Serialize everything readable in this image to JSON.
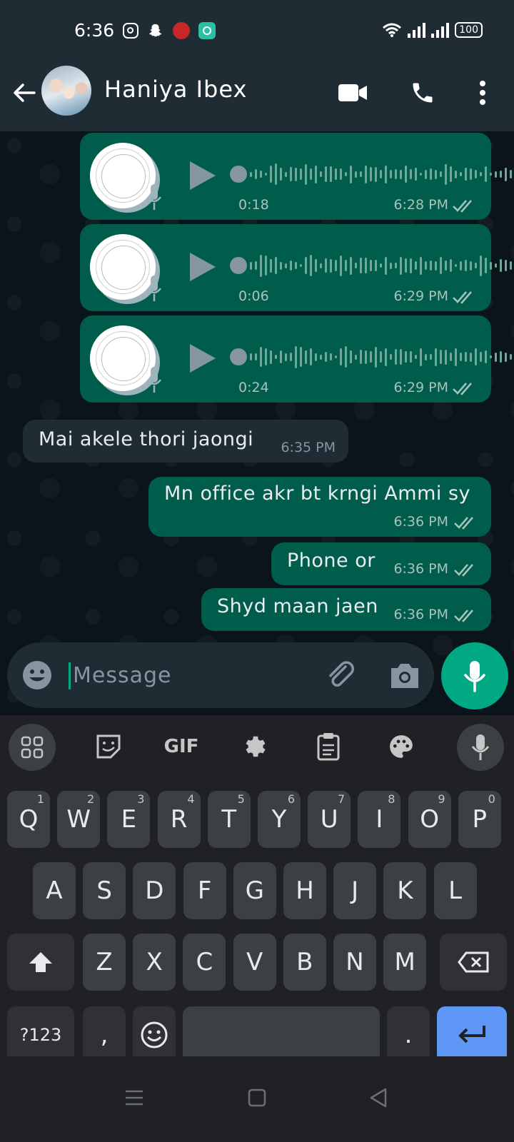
{
  "status_bar": {
    "time": "6:36",
    "battery": "100",
    "icons": [
      "instagram-icon",
      "snapchat-icon",
      "notification-app-icon",
      "chat-app-icon",
      "wifi-icon",
      "signal-icon",
      "signal-icon",
      "battery-icon"
    ]
  },
  "header": {
    "contact_name": "Haniya Ibex",
    "icons": [
      "back-arrow-icon",
      "video-call-icon",
      "phone-icon",
      "more-vert-icon"
    ]
  },
  "messages": [
    {
      "type": "voice",
      "direction": "out",
      "duration": "0:18",
      "time": "6:28 PM",
      "status": "read"
    },
    {
      "type": "voice",
      "direction": "out",
      "duration": "0:06",
      "time": "6:29 PM",
      "status": "read"
    },
    {
      "type": "voice",
      "direction": "out",
      "duration": "0:24",
      "time": "6:29 PM",
      "status": "read"
    },
    {
      "type": "text",
      "direction": "in",
      "text": "Mai akele thori jaongi",
      "time": "6:35 PM"
    },
    {
      "type": "text",
      "direction": "out",
      "text": "Mn office akr bt krngi Ammi sy",
      "time": "6:36 PM",
      "status": "read"
    },
    {
      "type": "text",
      "direction": "out",
      "text": "Phone or",
      "time": "6:36 PM",
      "status": "read"
    },
    {
      "type": "text",
      "direction": "out",
      "text": "Shyd maan jaen",
      "time": "6:36 PM",
      "status": "read"
    }
  ],
  "composer": {
    "placeholder": "Message",
    "icons": [
      "emoji-icon",
      "attach-icon",
      "camera-icon",
      "mic-icon"
    ]
  },
  "keyboard": {
    "toolbar": [
      "apps-grid-icon",
      "sticker-icon",
      "GIF",
      "settings-icon",
      "clipboard-icon",
      "palette-icon",
      "voice-input-icon"
    ],
    "row1": [
      [
        "Q",
        "1"
      ],
      [
        "W",
        "2"
      ],
      [
        "E",
        "3"
      ],
      [
        "R",
        "4"
      ],
      [
        "T",
        "5"
      ],
      [
        "Y",
        "6"
      ],
      [
        "U",
        "7"
      ],
      [
        "I",
        "8"
      ],
      [
        "O",
        "9"
      ],
      [
        "P",
        "0"
      ]
    ],
    "row2": [
      "A",
      "S",
      "D",
      "F",
      "G",
      "H",
      "J",
      "K",
      "L"
    ],
    "row3": [
      "Z",
      "X",
      "C",
      "V",
      "B",
      "N",
      "M"
    ],
    "symbols_label": "?123",
    "comma": ",",
    "period": "."
  },
  "colors": {
    "chat_bg": "#0b141a",
    "header_bg": "#1f2c34",
    "outgoing_bubble": "#005c4b",
    "incoming_bubble": "#202c33",
    "accent": "#00a884",
    "read_ticks": "#a7c4bb",
    "keyboard_bg": "#202124",
    "key_bg": "#3c4043",
    "enter_key": "#5e97f6"
  }
}
